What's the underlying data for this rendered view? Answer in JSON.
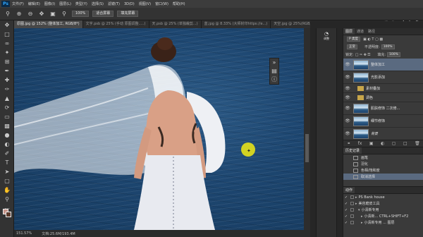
{
  "app": {
    "logo": "Ps",
    "brand": "虎课网"
  },
  "menubar": {
    "items": [
      "文件(F)",
      "编辑(E)",
      "图像(I)",
      "图层(L)",
      "类型(Y)",
      "选择(S)",
      "滤镜(T)",
      "3D(D)",
      "视图(V)",
      "窗口(W)",
      "帮助(H)"
    ]
  },
  "options": {
    "zoom_value": "100%",
    "btn1": "适合屏幕",
    "btn2": "填充屏幕",
    "check1": "缩放所有窗口",
    "check2": "细微缩放"
  },
  "tabs": [
    {
      "label": "原图.jpg @ 152% (整体加工, RGB/8*)",
      "active": true
    },
    {
      "label": "文字.psb @ 25% (手动 原图调整.....)",
      "active": false
    },
    {
      "label": "天.psb @ 25% (单独裁剪...)",
      "active": false
    },
    {
      "label": "蓝.jpg @ 8.33% (大师封印https://e...)",
      "active": false
    },
    {
      "label": "天空.jpg @ 25%(RGB/8...)",
      "active": false
    }
  ],
  "status": {
    "zoom": "151.57%",
    "doc": "文档:25.6M/193.4M"
  },
  "strip": {
    "btn_label": "调整"
  },
  "layers_panel": {
    "tabs": [
      "图层",
      "通道",
      "路径"
    ],
    "kind_label": "P 类型",
    "blend_mode": "正常",
    "opacity_label": "不透明度:",
    "opacity": "100%",
    "lock_label": "锁定:",
    "fill_label": "填充:",
    "fill": "100%",
    "layers": [
      {
        "name": "整体加工",
        "type": "pixel",
        "selected": true
      },
      {
        "name": "光影添加",
        "type": "pixel",
        "selected": false
      },
      {
        "name": "素材叠加",
        "type": "group",
        "selected": false
      },
      {
        "name": "调色",
        "type": "group",
        "selected": false
      },
      {
        "name": "肌肤修饰 二次修...",
        "type": "pixel",
        "selected": false
      },
      {
        "name": "细节修饰",
        "type": "pixel",
        "selected": false
      },
      {
        "name": "背景",
        "type": "pixel",
        "selected": false,
        "italic": true
      }
    ]
  },
  "history_panel": {
    "tabs": [
      "历史记录"
    ],
    "items": [
      {
        "label": "画笔",
        "selected": false
      },
      {
        "label": "羽化",
        "selected": false
      },
      {
        "label": "色相/饱和度",
        "selected": false
      },
      {
        "label": "取消选择",
        "selected": true
      }
    ]
  },
  "actions_panel": {
    "tabs": [
      "动作"
    ],
    "items": [
      {
        "label": "PS Bank house",
        "level": 0
      },
      {
        "label": "美容磨皮工具",
        "level": 0
      },
      {
        "label": "小清新专用",
        "level": 1
      },
      {
        "label": "小清新... CTRL+SHIFT+F2",
        "level": 2
      },
      {
        "label": "小清新专用 ... 图层",
        "level": 2
      }
    ]
  }
}
